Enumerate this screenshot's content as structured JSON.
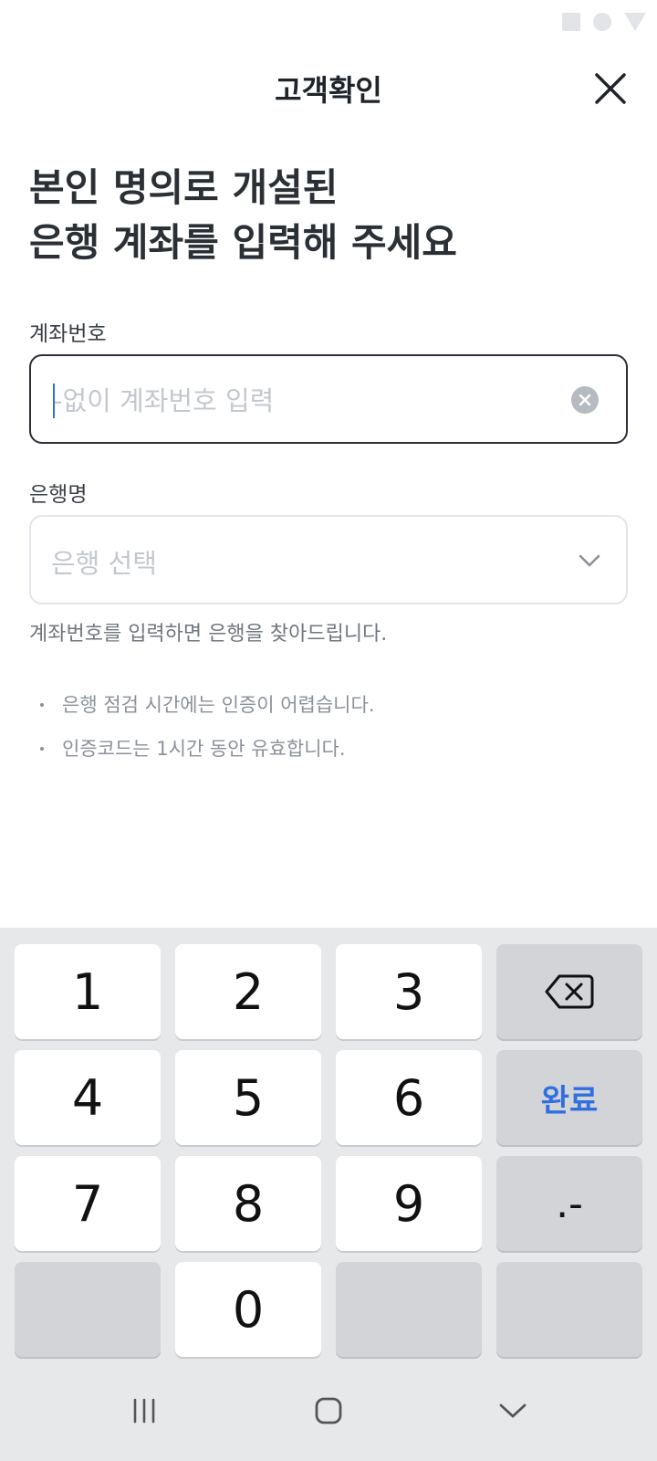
{
  "header": {
    "title": "고객확인"
  },
  "headline": {
    "line1": "본인 명의로 개설된",
    "line2": "은행 계좌를 입력해 주세요"
  },
  "account": {
    "label": "계좌번호",
    "placeholder": "-없이 계좌번호 입력",
    "value": ""
  },
  "bank": {
    "label": "은행명",
    "placeholder": "은행 선택"
  },
  "hint": "계좌번호를 입력하면 은행을 찾아드립니다.",
  "notes": [
    "은행 점검 시간에는 인증이 어렵습니다.",
    "인증코드는 1시간 동안 유효합니다."
  ],
  "keypad": {
    "k1": "1",
    "k2": "2",
    "k3": "3",
    "k4": "4",
    "k5": "5",
    "k6": "6",
    "k7": "7",
    "k8": "8",
    "k9": "9",
    "k0": "0",
    "done": "완료",
    "dotdash": ".-"
  },
  "icons": {
    "close": "close-icon",
    "clear": "clear-circle-icon",
    "dropdown": "chevron-down-icon",
    "backspace": "backspace-icon",
    "recents": "recents-icon",
    "home": "home-icon",
    "back": "back-chevron-icon"
  },
  "colors": {
    "accent": "#2f6fe0",
    "text": "#2b2f36",
    "keypad_bg": "#e7e8ea"
  }
}
